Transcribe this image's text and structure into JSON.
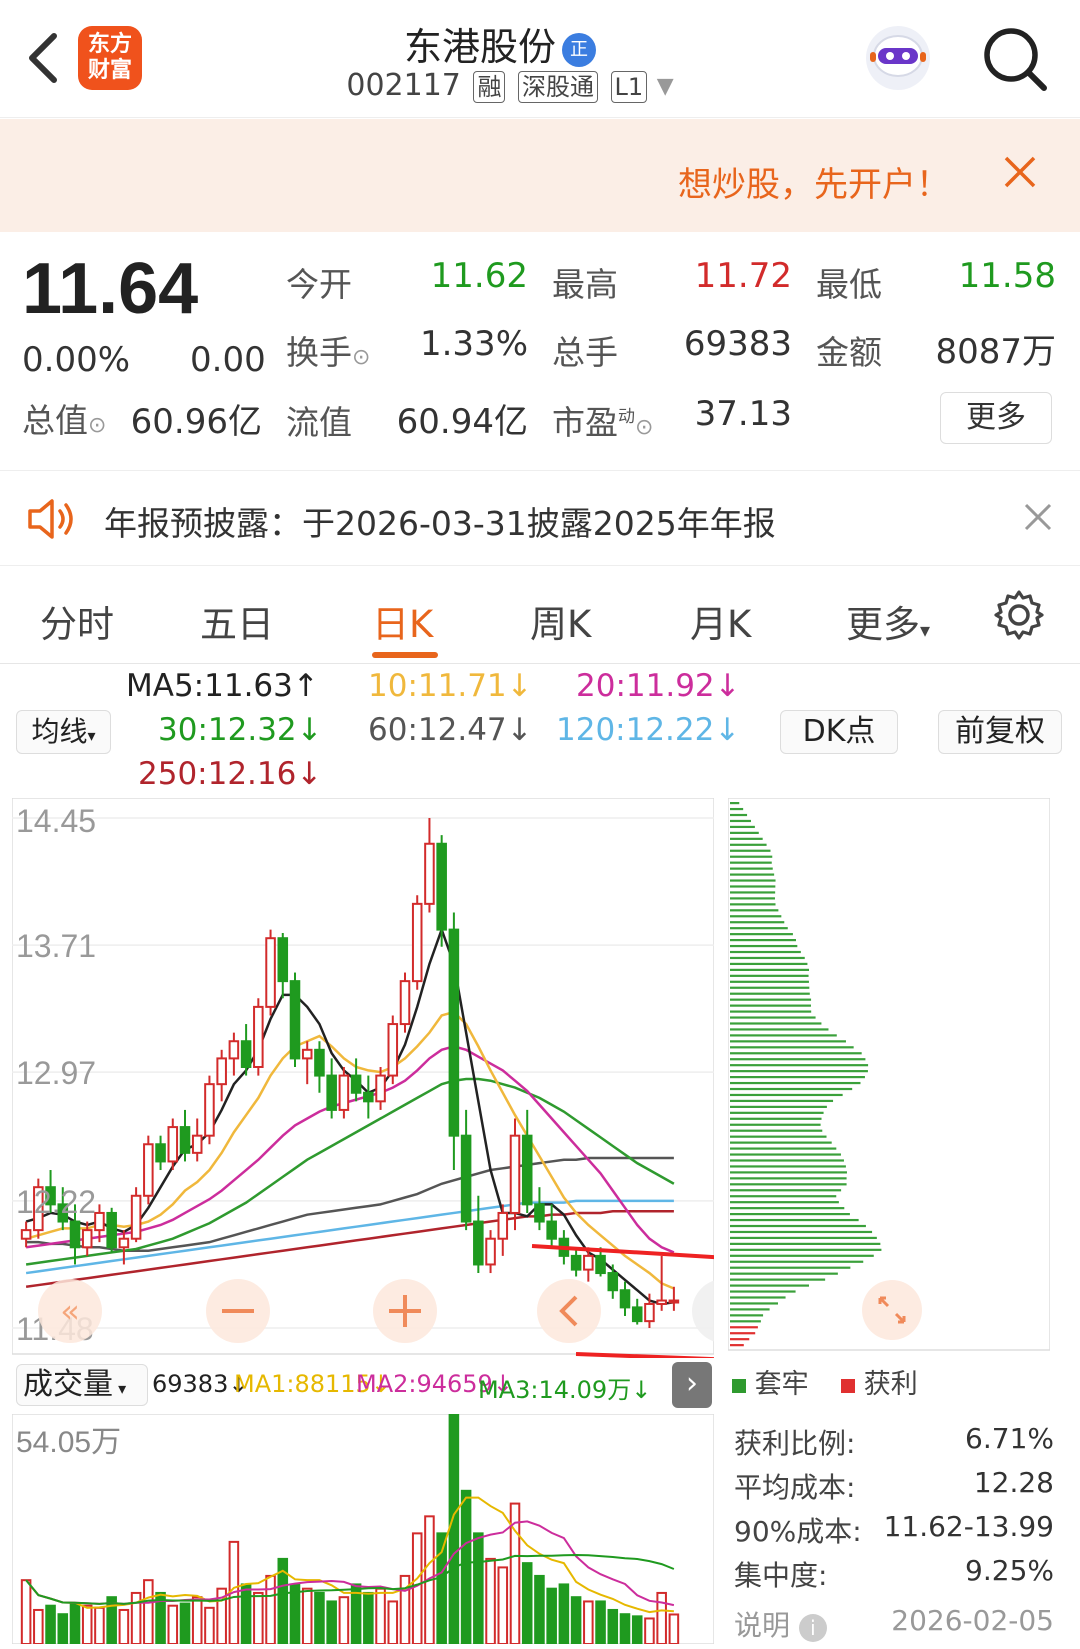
{
  "header": {
    "logo_text_1": "东方",
    "logo_text_2": "财富",
    "stock_name": "东港股份",
    "name_tag": "正",
    "code": "002117",
    "badges": [
      "融",
      "深股通",
      "L1"
    ]
  },
  "banner": {
    "text": "想炒股，先开户！"
  },
  "quote": {
    "price": "11.64",
    "change_pct": "0.00%",
    "change": "0.00",
    "fields": [
      {
        "label": "今开",
        "value": "11.62",
        "color": "green"
      },
      {
        "label": "最高",
        "value": "11.72",
        "color": "red"
      },
      {
        "label": "最低",
        "value": "11.58",
        "color": "green"
      },
      {
        "label": "换手",
        "value": "1.33%",
        "color": "normal"
      },
      {
        "label": "总手",
        "value": "69383",
        "color": "normal"
      },
      {
        "label": "金额",
        "value": "8087万",
        "color": "normal"
      },
      {
        "label": "总值",
        "value": "60.96亿",
        "color": "normal"
      },
      {
        "label": "流值",
        "value": "60.94亿",
        "color": "normal"
      },
      {
        "label": "市盈",
        "value": "37.13",
        "color": "normal"
      }
    ],
    "pe_superscript": "动",
    "more_label": "更多"
  },
  "notice": {
    "text": "年报预披露：于2026-03-31披露2025年年报"
  },
  "tabs": [
    "分时",
    "五日",
    "日K",
    "周K",
    "月K",
    "更多"
  ],
  "active_tab": "日K",
  "ma": {
    "button_label": "均线",
    "ma5": "MA5:11.63",
    "ma10": "10:11.71",
    "ma20": "20:11.92",
    "ma30": "30:12.32",
    "ma60": "60:12.47",
    "ma120": "120:12.22",
    "ma250": "250:12.16",
    "dk_label": "DK点",
    "fq_label": "前复权"
  },
  "colors": {
    "up": "#d22b2b",
    "down": "#1f9a1f",
    "ma5": "#222222",
    "ma10": "#f0b83c",
    "ma20": "#cc2d9c",
    "ma30": "#2f9a2f",
    "ma60": "#555555",
    "ma120": "#5fb6e6",
    "ma250": "#b0242c",
    "accent": "#e8651c"
  },
  "chart_data": [
    {
      "type": "candlestick",
      "y_ticks": [
        "14.45",
        "13.71",
        "12.97",
        "12.22",
        "11.48"
      ],
      "ylim": [
        11.48,
        14.45
      ],
      "candles": [
        [
          12.0,
          12.1,
          11.95,
          12.05
        ],
        [
          12.05,
          12.35,
          12.0,
          12.3
        ],
        [
          12.3,
          12.4,
          12.15,
          12.2
        ],
        [
          12.2,
          12.3,
          12.05,
          12.1
        ],
        [
          12.1,
          12.2,
          11.85,
          11.95
        ],
        [
          11.95,
          12.1,
          11.9,
          12.05
        ],
        [
          12.05,
          12.2,
          11.98,
          12.15
        ],
        [
          12.15,
          12.18,
          11.92,
          11.95
        ],
        [
          11.95,
          12.05,
          11.85,
          12.0
        ],
        [
          12.0,
          12.3,
          11.98,
          12.25
        ],
        [
          12.25,
          12.6,
          12.2,
          12.55
        ],
        [
          12.55,
          12.6,
          12.4,
          12.45
        ],
        [
          12.45,
          12.7,
          12.4,
          12.65
        ],
        [
          12.65,
          12.75,
          12.45,
          12.5
        ],
        [
          12.5,
          12.7,
          12.45,
          12.6
        ],
        [
          12.6,
          12.95,
          12.55,
          12.9
        ],
        [
          12.9,
          13.1,
          12.8,
          13.05
        ],
        [
          13.05,
          13.2,
          12.95,
          13.15
        ],
        [
          13.15,
          13.25,
          12.95,
          13.0
        ],
        [
          13.0,
          13.4,
          12.95,
          13.35
        ],
        [
          13.35,
          13.8,
          13.3,
          13.75
        ],
        [
          13.75,
          13.78,
          13.4,
          13.5
        ],
        [
          13.5,
          13.55,
          13.0,
          13.05
        ],
        [
          13.05,
          13.15,
          12.9,
          13.1
        ],
        [
          13.1,
          13.15,
          12.85,
          12.95
        ],
        [
          12.95,
          13.05,
          12.7,
          12.75
        ],
        [
          12.75,
          13.0,
          12.7,
          12.95
        ],
        [
          12.95,
          13.05,
          12.8,
          12.85
        ],
        [
          12.85,
          12.95,
          12.7,
          12.8
        ],
        [
          12.8,
          13.0,
          12.75,
          12.95
        ],
        [
          12.95,
          13.3,
          12.9,
          13.25
        ],
        [
          13.25,
          13.55,
          13.2,
          13.5
        ],
        [
          13.5,
          14.0,
          13.45,
          13.95
        ],
        [
          13.95,
          14.45,
          13.9,
          14.3
        ],
        [
          14.3,
          14.35,
          13.7,
          13.8
        ],
        [
          13.8,
          13.9,
          12.4,
          12.6
        ],
        [
          12.6,
          12.75,
          12.05,
          12.1
        ],
        [
          12.1,
          12.25,
          11.8,
          11.85
        ],
        [
          11.85,
          12.05,
          11.8,
          12.0
        ],
        [
          12.0,
          12.2,
          11.9,
          12.15
        ],
        [
          12.15,
          12.7,
          12.05,
          12.6
        ],
        [
          12.6,
          12.75,
          12.15,
          12.2
        ],
        [
          12.2,
          12.3,
          12.05,
          12.1
        ],
        [
          12.1,
          12.2,
          11.95,
          12.0
        ],
        [
          12.0,
          12.05,
          11.85,
          11.9
        ],
        [
          11.9,
          11.95,
          11.78,
          11.82
        ],
        [
          11.82,
          11.95,
          11.75,
          11.9
        ],
        [
          11.9,
          11.95,
          11.78,
          11.8
        ],
        [
          11.8,
          11.85,
          11.65,
          11.7
        ],
        [
          11.7,
          11.75,
          11.55,
          11.6
        ],
        [
          11.6,
          11.65,
          11.5,
          11.52
        ],
        [
          11.52,
          11.68,
          11.48,
          11.62
        ],
        [
          11.62,
          11.9,
          11.58,
          11.64
        ],
        [
          11.64,
          11.72,
          11.58,
          11.64
        ]
      ],
      "ma_lines": {
        "ma5": [
          12.1,
          12.12,
          12.15,
          12.14,
          12.1,
          12.08,
          12.1,
          12.06,
          12.04,
          12.08,
          12.18,
          12.3,
          12.42,
          12.52,
          12.55,
          12.62,
          12.75,
          12.9,
          12.98,
          13.1,
          13.28,
          13.42,
          13.42,
          13.35,
          13.25,
          13.08,
          12.98,
          12.92,
          12.85,
          12.88,
          12.98,
          13.13,
          13.35,
          13.6,
          13.8,
          13.6,
          13.2,
          12.8,
          12.4,
          12.15,
          12.15,
          12.13,
          12.2,
          12.2,
          12.14,
          12.02,
          11.92,
          11.88,
          11.82,
          11.76,
          11.7,
          11.64,
          11.62,
          11.63
        ],
        "ma10": [
          12.0,
          12.02,
          12.04,
          12.06,
          12.06,
          12.06,
          12.08,
          12.08,
          12.07,
          12.08,
          12.1,
          12.14,
          12.2,
          12.28,
          12.33,
          12.4,
          12.5,
          12.62,
          12.72,
          12.82,
          12.95,
          13.05,
          13.12,
          13.15,
          13.18,
          13.12,
          13.05,
          13.0,
          12.98,
          12.97,
          13.0,
          13.05,
          13.12,
          13.2,
          13.3,
          13.32,
          13.25,
          13.12,
          12.98,
          12.85,
          12.72,
          12.6,
          12.48,
          12.36,
          12.24,
          12.15,
          12.08,
          12.02,
          11.96,
          11.9,
          11.85,
          11.8,
          11.74,
          11.71
        ],
        "ma20": [
          11.95,
          11.96,
          11.97,
          11.98,
          11.99,
          12.0,
          12.01,
          12.02,
          12.03,
          12.04,
          12.06,
          12.08,
          12.11,
          12.15,
          12.19,
          12.23,
          12.28,
          12.34,
          12.4,
          12.46,
          12.53,
          12.6,
          12.66,
          12.7,
          12.74,
          12.77,
          12.79,
          12.81,
          12.83,
          12.85,
          12.88,
          12.92,
          12.98,
          13.05,
          13.1,
          13.12,
          13.1,
          13.06,
          13.02,
          12.98,
          12.92,
          12.86,
          12.78,
          12.7,
          12.62,
          12.54,
          12.46,
          12.38,
          12.28,
          12.18,
          12.08,
          12.0,
          11.95,
          11.92
        ],
        "ma30": [
          11.85,
          11.86,
          11.87,
          11.88,
          11.89,
          11.9,
          11.91,
          11.92,
          11.93,
          11.94,
          11.96,
          11.98,
          12.0,
          12.03,
          12.06,
          12.09,
          12.13,
          12.17,
          12.21,
          12.26,
          12.31,
          12.36,
          12.41,
          12.46,
          12.5,
          12.54,
          12.58,
          12.62,
          12.66,
          12.7,
          12.74,
          12.78,
          12.82,
          12.86,
          12.9,
          12.92,
          12.93,
          12.93,
          12.92,
          12.9,
          12.88,
          12.85,
          12.82,
          12.78,
          12.74,
          12.69,
          12.64,
          12.59,
          12.54,
          12.49,
          12.44,
          12.4,
          12.36,
          12.32
        ],
        "ma60": [
          11.98,
          11.98,
          11.97,
          11.97,
          11.96,
          11.95,
          11.95,
          11.94,
          11.93,
          11.93,
          11.93,
          11.94,
          11.95,
          11.96,
          11.97,
          11.98,
          12.0,
          12.02,
          12.04,
          12.06,
          12.08,
          12.1,
          12.12,
          12.14,
          12.15,
          12.16,
          12.17,
          12.18,
          12.19,
          12.2,
          12.22,
          12.24,
          12.26,
          12.29,
          12.32,
          12.34,
          12.36,
          12.38,
          12.4,
          12.41,
          12.42,
          12.43,
          12.44,
          12.45,
          12.46,
          12.46,
          12.47,
          12.47,
          12.47,
          12.47,
          12.47,
          12.47,
          12.47,
          12.47
        ],
        "ma120": [
          11.8,
          11.81,
          11.82,
          11.83,
          11.84,
          11.85,
          11.86,
          11.87,
          11.88,
          11.89,
          11.9,
          11.91,
          11.92,
          11.93,
          11.94,
          11.95,
          11.96,
          11.97,
          11.98,
          11.99,
          12.0,
          12.01,
          12.02,
          12.03,
          12.04,
          12.05,
          12.06,
          12.07,
          12.08,
          12.09,
          12.1,
          12.11,
          12.12,
          12.13,
          12.14,
          12.15,
          12.16,
          12.17,
          12.18,
          12.19,
          12.2,
          12.21,
          12.21,
          12.21,
          12.21,
          12.22,
          12.22,
          12.22,
          12.22,
          12.22,
          12.22,
          12.22,
          12.22,
          12.22
        ],
        "ma250": [
          11.72,
          11.73,
          11.74,
          11.75,
          11.76,
          11.77,
          11.78,
          11.79,
          11.8,
          11.81,
          11.82,
          11.83,
          11.84,
          11.85,
          11.86,
          11.87,
          11.88,
          11.89,
          11.9,
          11.91,
          11.92,
          11.93,
          11.94,
          11.95,
          11.96,
          11.97,
          11.98,
          11.99,
          12.0,
          12.01,
          12.02,
          12.03,
          12.04,
          12.05,
          12.06,
          12.07,
          12.08,
          12.09,
          12.1,
          12.11,
          12.12,
          12.13,
          12.13,
          12.14,
          12.14,
          12.15,
          12.15,
          12.15,
          12.16,
          12.16,
          12.16,
          12.16,
          12.16,
          12.16
        ]
      }
    },
    {
      "type": "bar",
      "title": "成交量",
      "y_ticks": [
        "54.05万"
      ],
      "ylim": [
        0,
        540500
      ],
      "values": [
        150000,
        80000,
        90000,
        70000,
        95000,
        90000,
        85000,
        110000,
        80000,
        120000,
        150000,
        120000,
        90000,
        95000,
        110000,
        85000,
        130000,
        240000,
        140000,
        120000,
        160000,
        200000,
        140000,
        130000,
        120000,
        100000,
        110000,
        140000,
        120000,
        130000,
        100000,
        160000,
        260000,
        300000,
        260000,
        540500,
        360000,
        260000,
        200000,
        180000,
        330000,
        190000,
        160000,
        130000,
        140000,
        110000,
        100000,
        100000,
        80000,
        70000,
        65000,
        60000,
        120000,
        69383
      ],
      "ma1": "69383",
      "ma1_label": "MA1:88115",
      "ma2_label": "MA2:94659",
      "ma3_label": "MA3:14.09万"
    },
    {
      "type": "bar",
      "subtype": "chip-distribution",
      "legend": [
        "套牢",
        "获利"
      ]
    }
  ],
  "chip": {
    "legend_trapped": "套牢",
    "legend_profit": "获利",
    "rows": [
      {
        "label": "获利比例:",
        "value": "6.71%"
      },
      {
        "label": "平均成本:",
        "value": "12.28"
      },
      {
        "label": "90%成本:",
        "value": "11.62-13.99"
      },
      {
        "label": "集中度:",
        "value": "9.25%"
      }
    ],
    "note_label": "说明",
    "date": "2026-02-05"
  },
  "volume": {
    "selector_label": "成交量",
    "current": "69383",
    "ma1": "MA1:88115",
    "ma2": "MA2:94659",
    "ma3": "MA3:14.09万"
  }
}
